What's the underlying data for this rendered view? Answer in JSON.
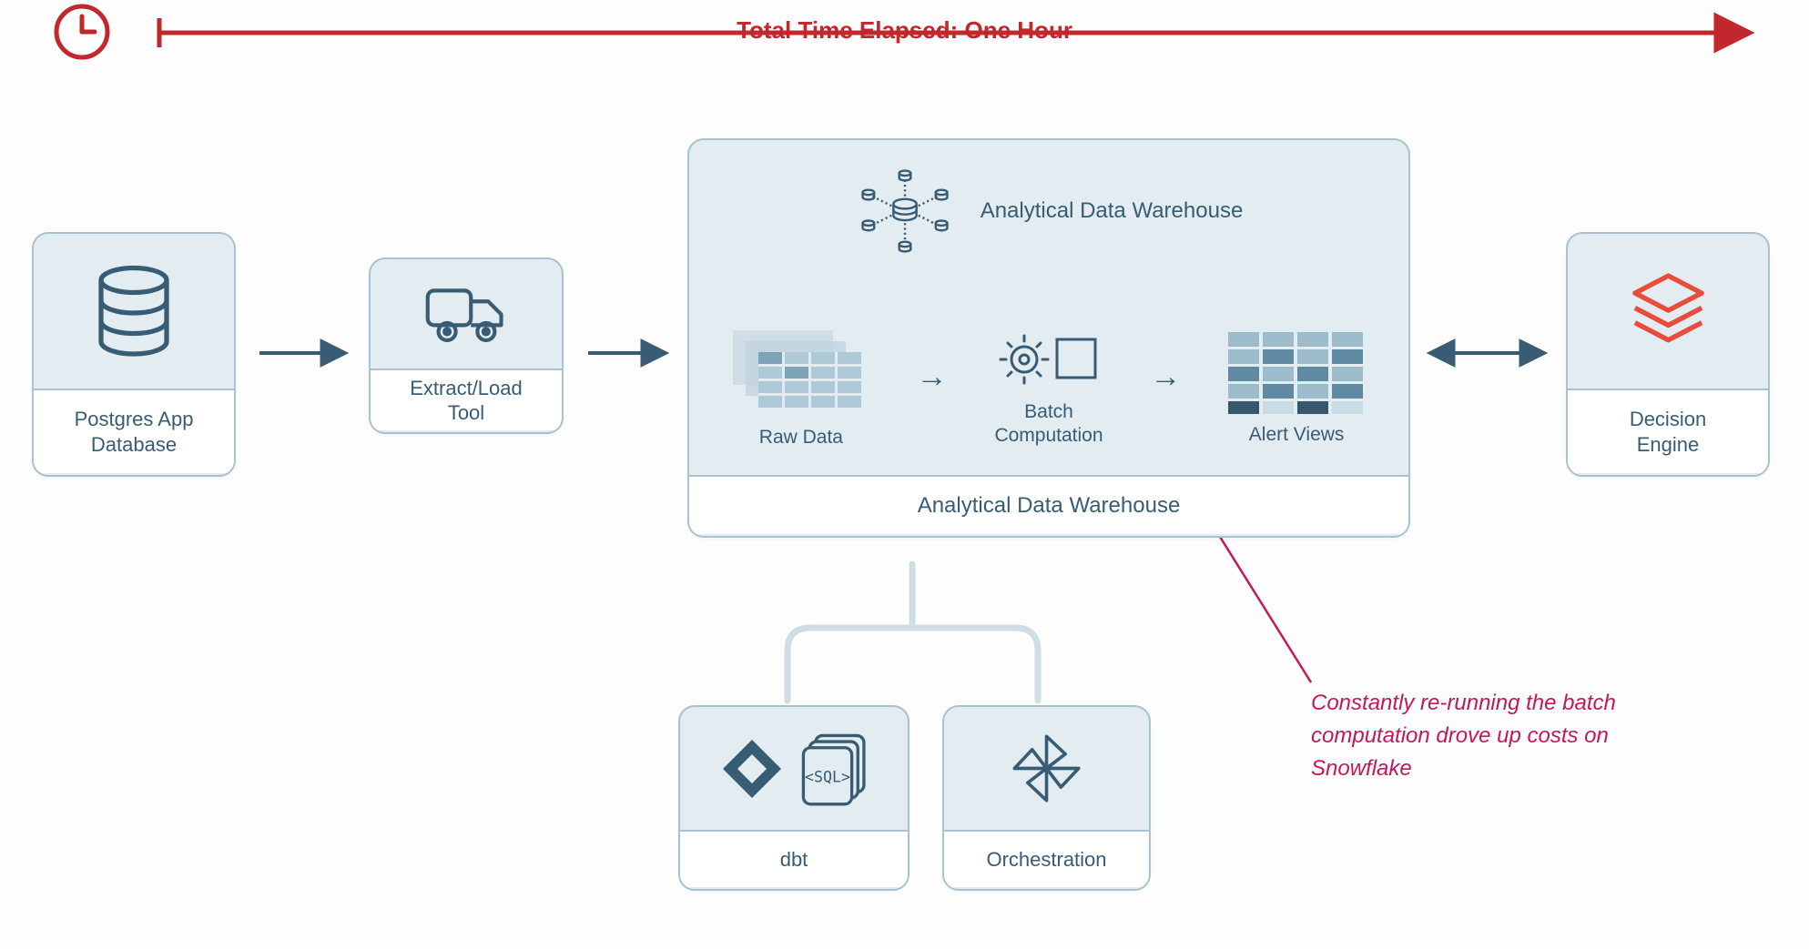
{
  "timeline": {
    "label": "Total Time Elapsed: One Hour"
  },
  "nodes": {
    "database": {
      "label": "Postgres App\nDatabase"
    },
    "etl": {
      "label": "Extract/Load\nTool"
    },
    "warehouse": {
      "header": "Analytical Data Warehouse",
      "label": "Analytical Data Warehouse",
      "steps": {
        "raw": "Raw Data",
        "batch": "Batch\nComputation",
        "views": "Alert Views"
      }
    },
    "decision": {
      "label": "Decision\nEngine"
    },
    "dbt": {
      "label": "dbt",
      "sql_badge": "SQL"
    },
    "orchestration": {
      "label": "Orchestration"
    }
  },
  "annotation": "Constantly re-running the batch computation drove up costs on Snowflake",
  "colors": {
    "ink": "#385c74",
    "panel_bg": "#e2ecf1",
    "panel_border": "#a8c2d0",
    "red": "#c1272d",
    "pink": "#c2185b",
    "orange": "#e74c3c"
  }
}
